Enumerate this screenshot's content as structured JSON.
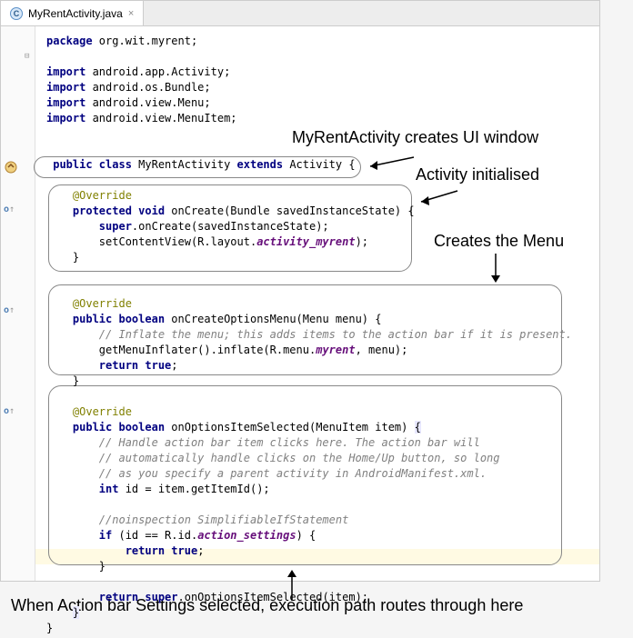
{
  "tab": {
    "icon_letter": "C",
    "filename": "MyRentActivity.java",
    "close": "×"
  },
  "code": {
    "package_kw": "package ",
    "package_name": "org.wit.myrent;",
    "import_kw": "import ",
    "imports": [
      "android.app.Activity;",
      "android.os.Bundle;",
      "android.view.Menu;",
      "android.view.MenuItem;"
    ],
    "class_decl": {
      "public": "public class ",
      "name": "MyRentActivity ",
      "extends": "extends ",
      "parent": "Activity {"
    },
    "override": "@Override",
    "onCreate": {
      "sig_pre": "protected void ",
      "sig_name": "onCreate(Bundle savedInstanceState) {",
      "l1a": "super",
      "l1b": ".onCreate(savedInstanceState);",
      "l2a": "setContentView(R.layout.",
      "l2b": "activity_myrent",
      "l2c": ");"
    },
    "onCreateOptions": {
      "sig_pre": "public boolean ",
      "sig_name": "onCreateOptionsMenu(Menu menu) {",
      "cmt": "// Inflate the menu; this adds items to the action bar if it is present.",
      "l1a": "getMenuInflater().inflate(R.menu.",
      "l1b": "myrent",
      "l1c": ", menu);",
      "ret": "return true",
      "semi": ";"
    },
    "onOptionsItem": {
      "sig_pre": "public boolean ",
      "sig_name": "onOptionsItemSelected(MenuItem item) ",
      "brace": "{",
      "c1": "// Handle action bar item clicks here. The action bar will",
      "c2": "// automatically handle clicks on the Home/Up button, so long",
      "c3": "// as you specify a parent activity in AndroidManifest.xml.",
      "l1a": "int ",
      "l1b": "id = item.getItemId();",
      "c4": "//noinspection SimplifiableIfStatement",
      "l2a": "if ",
      "l2b": "(id == R.id.",
      "l2c": "action_settings",
      "l2d": ") {",
      "ret1": "return true",
      "semi1": ";",
      "cb1": "}",
      "ret2a": "return super",
      "ret2b": ".onOptionsItemSelected(item);",
      "cb2": "}"
    },
    "class_close": "}"
  },
  "annotations": {
    "a1": "MyRentActivity creates UI window",
    "a2": "Activity initialised",
    "a3": "Creates the Menu",
    "a4": "When Action bar Settings selected, execution path routes through here"
  }
}
